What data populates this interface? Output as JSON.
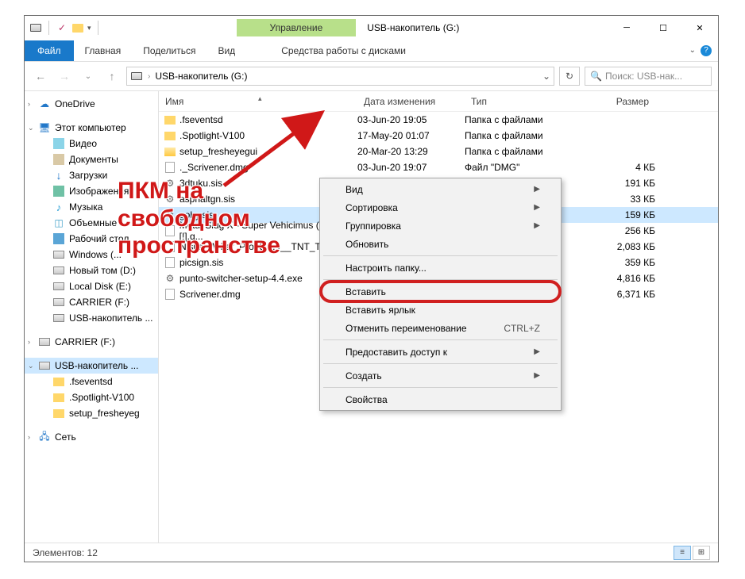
{
  "titlebar": {
    "manage_label": "Управление",
    "title": "USB-накопитель (G:)"
  },
  "ribbon": {
    "file": "Файл",
    "home": "Главная",
    "share": "Поделиться",
    "view": "Вид",
    "drive_tools": "Средства работы с дисками"
  },
  "address": {
    "path": "USB-накопитель (G:)",
    "search_placeholder": "Поиск: USB-нак..."
  },
  "nav": {
    "onedrive": "OneDrive",
    "this_pc": "Этот компьютер",
    "videos": "Видео",
    "documents": "Документы",
    "downloads": "Загрузки",
    "pictures": "Изображения",
    "music": "Музыка",
    "objects3d": "Объемные ...",
    "desktop": "Рабочий стол",
    "windows_c": "Windows (...",
    "new_vol_d": "Новый том (D:)",
    "local_e": "Local Disk (E:)",
    "carrier_f": "CARRIER (F:)",
    "usb_g": "USB-накопитель ...",
    "carrier_f2": "CARRIER (F:)",
    "usb_root": "USB-накопитель ...",
    "fsevents": ".fseventsd",
    "spotlight": ".Spotlight-V100",
    "setup_fresh": "setup_fresheyeg",
    "network": "Сеть"
  },
  "columns": {
    "name": "Имя",
    "date": "Дата изменения",
    "type": "Тип",
    "size": "Размер"
  },
  "rows": [
    {
      "name": ".fseventsd",
      "date": "03-Jun-20 19:05",
      "type": "Папка с файлами",
      "size": "",
      "icon": "fold"
    },
    {
      "name": ".Spotlight-V100",
      "date": "17-May-20 01:07",
      "type": "Папка с файлами",
      "size": "",
      "icon": "fold"
    },
    {
      "name": "setup_fresheyegui",
      "date": "20-Mar-20 13:29",
      "type": "Папка с файлами",
      "size": "",
      "icon": "fold2"
    },
    {
      "name": "._Scrivener.dmg",
      "date": "03-Jun-20 19:07",
      "type": "Файл \"DMG\"",
      "size": "4 КБ",
      "icon": "file"
    },
    {
      "name": "3dtuku.sis",
      "date": "",
      "type": "",
      "size": "191 КБ",
      "icon": "exe"
    },
    {
      "name": "asphaltgn.sis",
      "date": "",
      "type": "",
      "size": "33 КБ",
      "icon": "exe"
    },
    {
      "name": "goby.sis",
      "date": "",
      "type": "",
      "size": "159 КБ",
      "icon": "exe",
      "sel": true
    },
    {
      "name": "Metal Slug X - Super Vehicimus (UE) [!].g...",
      "date": "",
      "type": "",
      "size": "256 КБ",
      "icon": "file"
    },
    {
      "name": "Nisus_Writer_Pro_3.0.4__TNT_Torrentr...",
      "date": "",
      "type": "",
      "size": "2,083 КБ",
      "icon": "file"
    },
    {
      "name": "picsign.sis",
      "date": "",
      "type": "",
      "size": "359 КБ",
      "icon": "file"
    },
    {
      "name": "punto-switcher-setup-4.4.exe",
      "date": "",
      "type": "",
      "size": "4,816 КБ",
      "icon": "exe"
    },
    {
      "name": "Scrivener.dmg",
      "date": "",
      "type": "",
      "size": "6,371 КБ",
      "icon": "file"
    }
  ],
  "context_menu": {
    "view": "Вид",
    "sort": "Сортировка",
    "group": "Группировка",
    "refresh": "Обновить",
    "customize": "Настроить папку...",
    "paste": "Вставить",
    "paste_shortcut": "Вставить ярлык",
    "undo_rename": "Отменить переименование",
    "undo_shortcut": "CTRL+Z",
    "share": "Предоставить доступ к",
    "new": "Создать",
    "properties": "Свойства"
  },
  "status": {
    "items": "Элементов: 12"
  },
  "annotation": {
    "line1": "ПКМ на",
    "line2": "свободном",
    "line3": "пространстве"
  }
}
